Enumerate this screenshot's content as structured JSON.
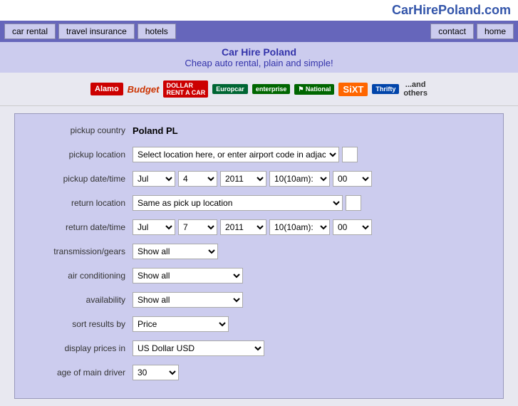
{
  "site": {
    "title": "CarhirePoland.com",
    "display_title": "CarHirePoland.com"
  },
  "nav": {
    "left_items": [
      "car rental",
      "travel insurance",
      "hotels"
    ],
    "right_items": [
      "contact",
      "home"
    ]
  },
  "header": {
    "line1": "Car Hire Poland",
    "line2": "Cheap auto rental, plain and simple!"
  },
  "logos": {
    "brands": [
      "Alamo",
      "Budget",
      "Dollar",
      "Europcar",
      "enterprise",
      "National",
      "SiXT",
      "Thrifty",
      "...and others"
    ]
  },
  "form": {
    "pickup_country_label": "pickup country",
    "pickup_country_value": "Poland PL",
    "pickup_location_label": "pickup location",
    "pickup_location_placeholder": "Select location here, or enter airport code in adjacent box >",
    "pickup_datetime_label": "pickup date/time",
    "pickup_month": "Jul",
    "pickup_day": "4",
    "pickup_year": "2011",
    "pickup_hour": "10(10am):",
    "pickup_min": "00",
    "return_location_label": "return location",
    "return_location_value": "Same as pick up location",
    "return_datetime_label": "return date/time",
    "return_month": "Jul",
    "return_day": "7",
    "return_year": "2011",
    "return_hour": "10(10am):",
    "return_min": "00",
    "transmission_label": "transmission/gears",
    "transmission_value": "Show all",
    "ac_label": "air conditioning",
    "ac_value": "Show all",
    "availability_label": "availability",
    "availability_value": "Show all",
    "sort_label": "sort results by",
    "sort_value": "Price",
    "prices_label": "display prices in",
    "prices_value": "US Dollar USD",
    "age_label": "age of main driver",
    "age_value": "30"
  }
}
